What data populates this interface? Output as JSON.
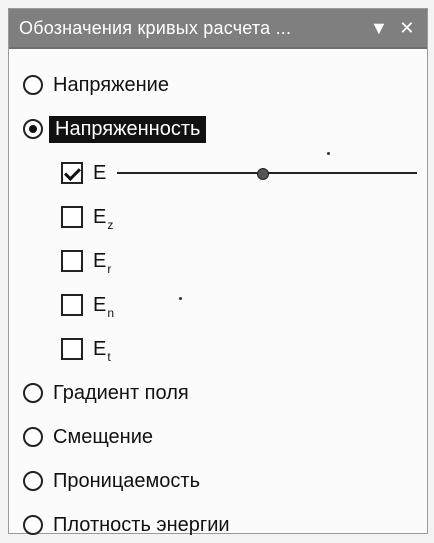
{
  "window": {
    "title": "Обозначения кривых расчета ...",
    "controls": {
      "dropdown_icon": "▼",
      "close_icon": "✕"
    }
  },
  "options": [
    {
      "label": "Напряжение",
      "selected": false
    },
    {
      "label": "Напряженность",
      "selected": true
    },
    {
      "label": "Градиент поля",
      "selected": false
    },
    {
      "label": "Смещение",
      "selected": false
    },
    {
      "label": "Проницаемость",
      "selected": false
    },
    {
      "label": "Плотность энергии",
      "selected": false
    }
  ],
  "components": [
    {
      "main": "E",
      "sub": "",
      "checked": true
    },
    {
      "main": "E",
      "sub": "z",
      "checked": false
    },
    {
      "main": "E",
      "sub": "r",
      "checked": false
    },
    {
      "main": "E",
      "sub": "n",
      "checked": false
    },
    {
      "main": "E",
      "sub": "t",
      "checked": false
    }
  ],
  "colors": {
    "titlebar": "#7f7f7f",
    "selected_label_bg": "#111111"
  }
}
